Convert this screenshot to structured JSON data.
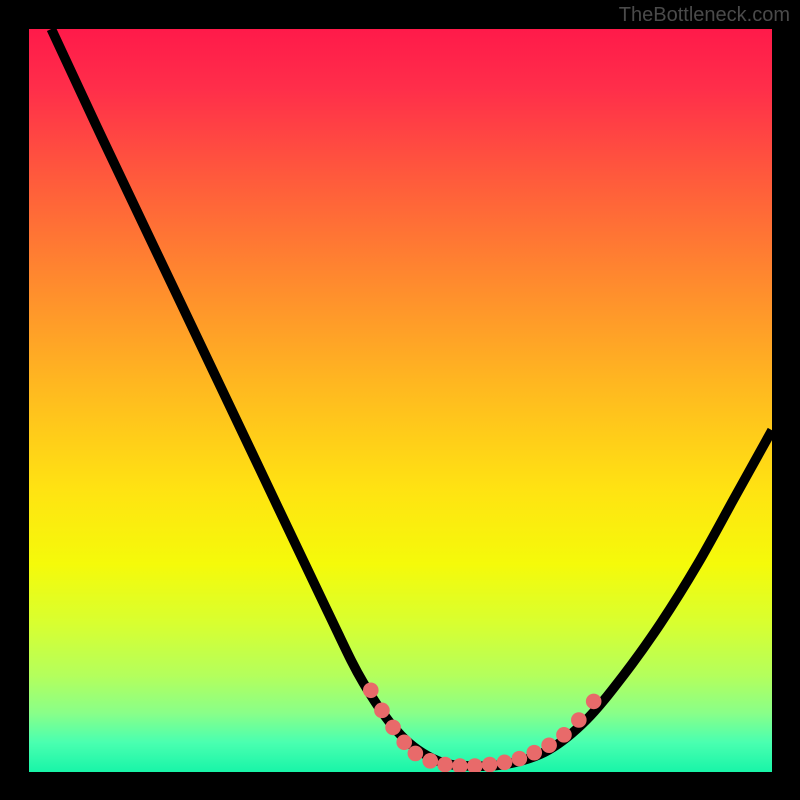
{
  "attribution": "TheBottleneck.com",
  "chart_data": {
    "type": "line",
    "title": "",
    "xlabel": "",
    "ylabel": "",
    "xlim": [
      0,
      100
    ],
    "ylim": [
      0,
      100
    ],
    "curve": {
      "name": "bottleneck-curve",
      "points": [
        {
          "x": 3,
          "y": 100
        },
        {
          "x": 10,
          "y": 85
        },
        {
          "x": 20,
          "y": 64
        },
        {
          "x": 30,
          "y": 43
        },
        {
          "x": 40,
          "y": 22
        },
        {
          "x": 45,
          "y": 12
        },
        {
          "x": 50,
          "y": 5
        },
        {
          "x": 55,
          "y": 1.5
        },
        {
          "x": 60,
          "y": 0.8
        },
        {
          "x": 65,
          "y": 1.2
        },
        {
          "x": 70,
          "y": 3
        },
        {
          "x": 75,
          "y": 7
        },
        {
          "x": 80,
          "y": 13
        },
        {
          "x": 85,
          "y": 20
        },
        {
          "x": 90,
          "y": 28
        },
        {
          "x": 95,
          "y": 37
        },
        {
          "x": 100,
          "y": 46
        }
      ]
    },
    "highlight_dots": [
      {
        "x": 46,
        "y": 11
      },
      {
        "x": 47.5,
        "y": 8.3
      },
      {
        "x": 49,
        "y": 6
      },
      {
        "x": 50.5,
        "y": 4
      },
      {
        "x": 52,
        "y": 2.5
      },
      {
        "x": 54,
        "y": 1.5
      },
      {
        "x": 56,
        "y": 1.0
      },
      {
        "x": 58,
        "y": 0.8
      },
      {
        "x": 60,
        "y": 0.8
      },
      {
        "x": 62,
        "y": 1.0
      },
      {
        "x": 64,
        "y": 1.3
      },
      {
        "x": 66,
        "y": 1.8
      },
      {
        "x": 68,
        "y": 2.6
      },
      {
        "x": 70,
        "y": 3.6
      },
      {
        "x": 72,
        "y": 5.0
      },
      {
        "x": 74,
        "y": 7.0
      },
      {
        "x": 76,
        "y": 9.5
      }
    ]
  }
}
